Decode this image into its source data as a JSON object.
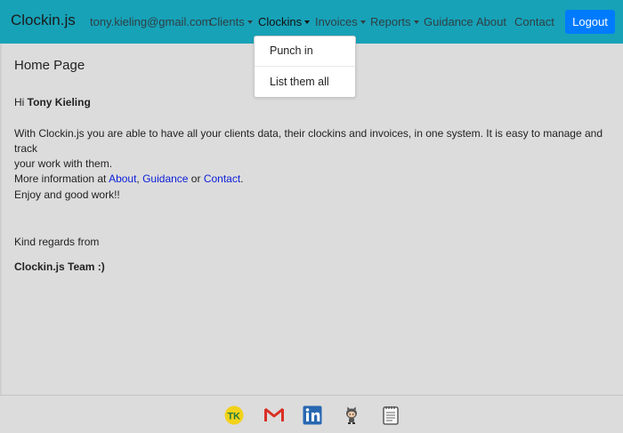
{
  "navbar": {
    "brand": "Clockin.js",
    "user_email": "tony.kieling@gmail.com",
    "items": [
      {
        "label": "Clients",
        "dropdown": true
      },
      {
        "label": "Clockins",
        "dropdown": true
      },
      {
        "label": "Invoices",
        "dropdown": true
      },
      {
        "label": "Reports",
        "dropdown": true
      },
      {
        "label": "Guidance",
        "dropdown": false
      },
      {
        "label": "About",
        "dropdown": false
      },
      {
        "label": "Contact",
        "dropdown": false
      }
    ],
    "logout_label": "Logout",
    "color": "#17a2b8"
  },
  "dropdown": {
    "items": [
      "Punch in",
      "List them all"
    ]
  },
  "main": {
    "title": "Home Page",
    "greeting_prefix": "Hi ",
    "user_name": "Tony Kieling",
    "intro_line1": "With Clockin.js you are able to have all your clients data, their clockins and invoices, in one system. It is easy to manage and track",
    "intro_line2": "your work with them.",
    "more_info_prefix": "More information at ",
    "link_about": "About",
    "sep_comma": ", ",
    "link_guidance": "Guidance",
    "sep_or": " or ",
    "link_contact": "Contact",
    "period": ".",
    "enjoy": "Enjoy and good work!!",
    "regards": "Kind regards from",
    "team": "Clockin.js Team :)"
  },
  "footer": {
    "icons": [
      "tk-logo-icon",
      "gmail-icon",
      "linkedin-icon",
      "github-icon",
      "notes-icon"
    ]
  }
}
